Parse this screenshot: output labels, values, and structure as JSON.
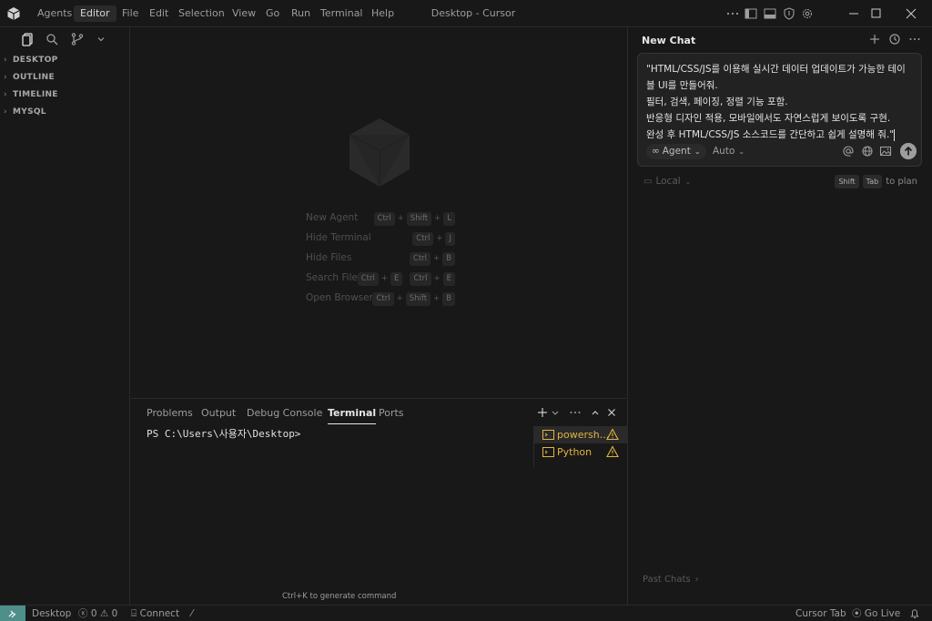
{
  "titlebar": {
    "menus": [
      "Agents",
      "Editor",
      "File",
      "Edit",
      "Selection",
      "View",
      "Go",
      "Run",
      "Terminal",
      "Help"
    ],
    "window_title": "Desktop - Cursor"
  },
  "sidebar": {
    "sections": [
      "DESKTOP",
      "OUTLINE",
      "TIMELINE",
      "MYSQL"
    ]
  },
  "editor": {
    "shortcuts": [
      {
        "label": "New Agent",
        "keys": [
          "Ctrl",
          "Shift",
          "L"
        ]
      },
      {
        "label": "Hide Terminal",
        "keys": [
          "Ctrl",
          "J"
        ]
      },
      {
        "label": "Hide Files",
        "keys": [
          "Ctrl",
          "B"
        ]
      },
      {
        "label": "Search Files",
        "keys": [
          "Ctrl",
          "E"
        ],
        "alt_keys": [
          "Ctrl",
          "E"
        ]
      },
      {
        "label": "Open Browser",
        "keys": [
          "Ctrl",
          "Shift",
          "B"
        ]
      }
    ]
  },
  "panel": {
    "tabs": [
      "Problems",
      "Output",
      "Debug Console",
      "Terminal",
      "Ports"
    ],
    "active_tab": "Terminal",
    "prompt": "PS C:\\Users\\사용자\\Desktop>",
    "terminals": [
      "powersh...",
      "Python"
    ],
    "generate_hint": "Ctrl+K to generate command"
  },
  "chat": {
    "title": "New Chat",
    "message_lines": [
      "\"HTML/CSS/JS를 이용해 실시간 데이터 업데이트가 가능한 테이",
      "블 UI를 만들어줘.",
      "필터, 검색, 페이징, 정렬 기능 포함.",
      "반응형 디자인 적용, 모바일에서도 자연스럽게 보이도록 구현.",
      "완성 후 HTML/CSS/JS 소스코드를 간단하고 쉽게 설명해 줘.\""
    ],
    "mode_label": "Agent",
    "model_label": "Auto",
    "location_label": "Local",
    "plan_keys": [
      "Shift",
      "Tab"
    ],
    "plan_suffix": "to plan",
    "past_chats": "Past Chats"
  },
  "statusbar": {
    "workspace": "Desktop",
    "errors": "0",
    "warnings": "0",
    "connect": "Connect",
    "cursor_tab": "Cursor Tab",
    "go_live": "Go Live"
  },
  "colors": {
    "background": "#181818",
    "terminal_name": "#e3b341",
    "warning": "#e3b341",
    "remote_button": "#4f8f8a"
  }
}
